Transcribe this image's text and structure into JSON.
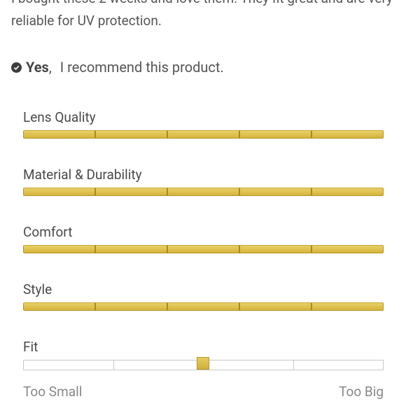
{
  "review": {
    "text": "I bought these 2 weeks and love them. They fit great and are very reliable for UV protection."
  },
  "recommendation": {
    "answer": "Yes",
    "separator": ",",
    "text": "I recommend this product."
  },
  "ratings": [
    {
      "label": "Lens Quality",
      "value": 5,
      "max": 5
    },
    {
      "label": "Material & Durability",
      "value": 5,
      "max": 5
    },
    {
      "label": "Comfort",
      "value": 5,
      "max": 5
    },
    {
      "label": "Style",
      "value": 5,
      "max": 5
    }
  ],
  "fit": {
    "label": "Fit",
    "min_label": "Too Small",
    "max_label": "Too Big",
    "value_fraction": 0.5
  },
  "colors": {
    "bar_fill": "#d9bb45",
    "track_border": "#c8c8c8"
  }
}
